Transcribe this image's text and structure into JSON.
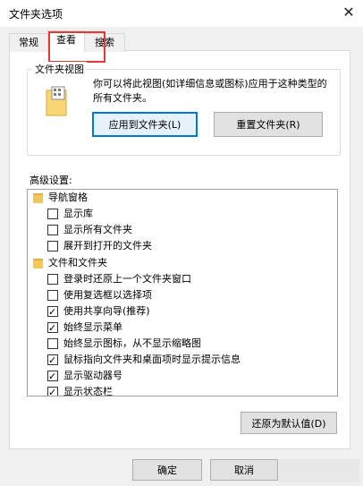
{
  "window": {
    "title": "文件夹选项",
    "close_glyph": "✕"
  },
  "tabs": [
    {
      "label": "常规",
      "active": false
    },
    {
      "label": "查看",
      "active": true
    },
    {
      "label": "搜索",
      "active": false
    }
  ],
  "folder_views": {
    "group_label": "文件夹视图",
    "description": "你可以将此视图(如详细信息或图标)应用于这种类型的所有文件夹。",
    "apply_button": "应用到文件夹(L)",
    "reset_button": "重置文件夹(R)"
  },
  "advanced": {
    "label": "高级设置:",
    "items": [
      {
        "type": "folder",
        "label": "导航窗格"
      },
      {
        "type": "checkbox",
        "label": "显示库",
        "checked": false
      },
      {
        "type": "checkbox",
        "label": "显示所有文件夹",
        "checked": false
      },
      {
        "type": "checkbox",
        "label": "展开到打开的文件夹",
        "checked": false
      },
      {
        "type": "folder",
        "label": "文件和文件夹"
      },
      {
        "type": "checkbox",
        "label": "登录时还原上一个文件夹窗口",
        "checked": false
      },
      {
        "type": "checkbox",
        "label": "使用复选框以选择项",
        "checked": false
      },
      {
        "type": "checkbox",
        "label": "使用共享向导(推荐)",
        "checked": true
      },
      {
        "type": "checkbox",
        "label": "始终显示菜单",
        "checked": true
      },
      {
        "type": "checkbox",
        "label": "始终显示图标，从不显示缩略图",
        "checked": false
      },
      {
        "type": "checkbox",
        "label": "鼠标指向文件夹和桌面项时显示提示信息",
        "checked": true
      },
      {
        "type": "checkbox",
        "label": "显示驱动器号",
        "checked": true
      },
      {
        "type": "checkbox",
        "label": "显示状态栏",
        "checked": true
      }
    ],
    "restore_button": "还原为默认值(D)",
    "scroll_up": "˄",
    "scroll_down": "˅"
  },
  "footer": {
    "ok_button": "确定",
    "cancel_button": "取消"
  }
}
